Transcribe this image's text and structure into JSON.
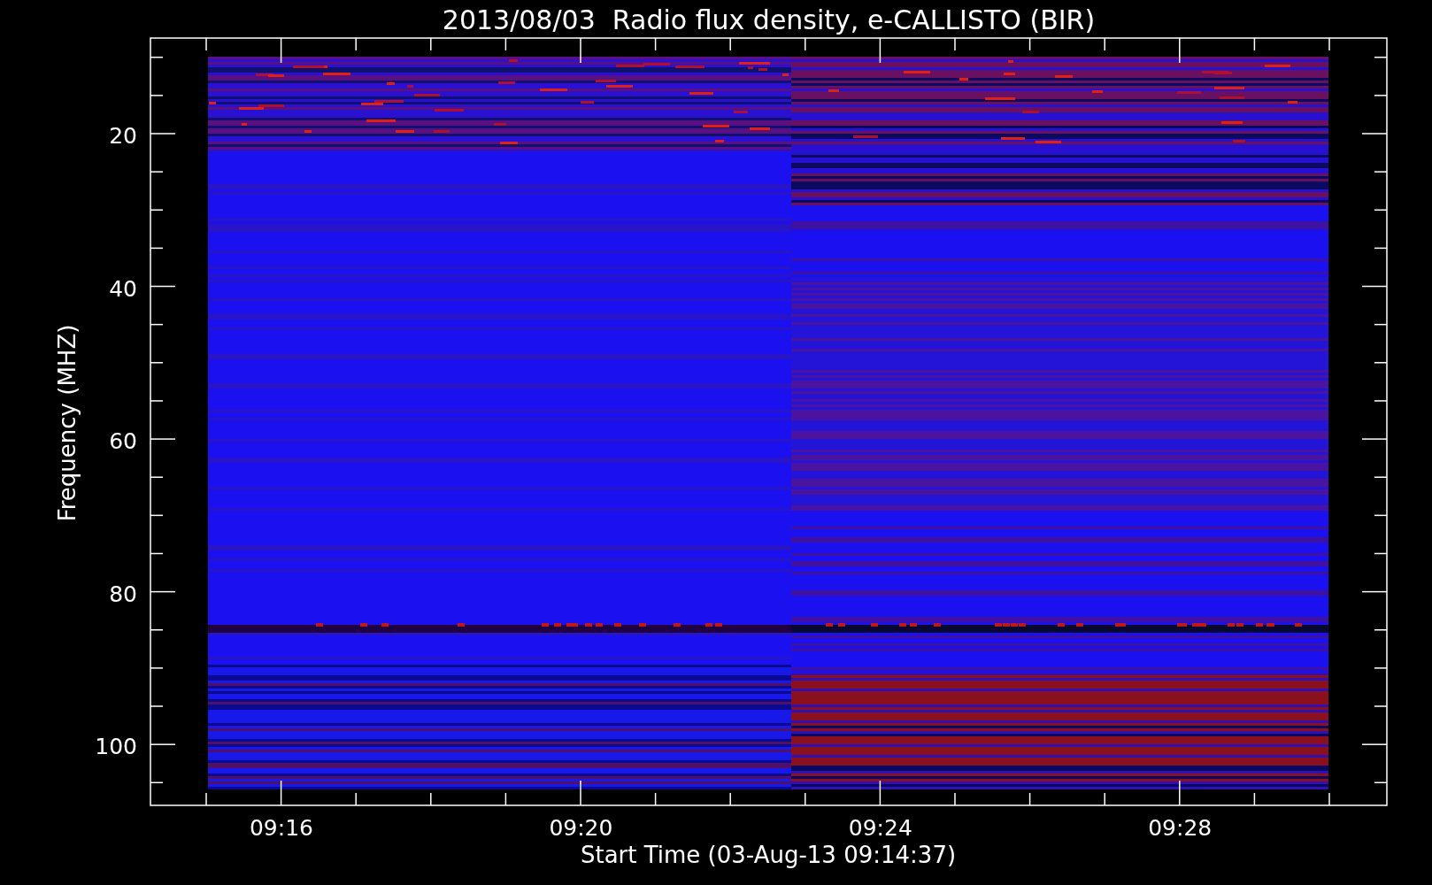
{
  "title": "2013/08/03  Radio flux density, e-CALLISTO (BIR)",
  "y_axis": {
    "label": "Frequency (MHZ)",
    "ticks": [
      "20",
      "40",
      "60",
      "80",
      "100"
    ]
  },
  "x_axis": {
    "label": "Start Time (03-Aug-13 09:14:37)",
    "ticks": [
      "09:16",
      "09:20",
      "09:24",
      "09:28"
    ]
  }
}
